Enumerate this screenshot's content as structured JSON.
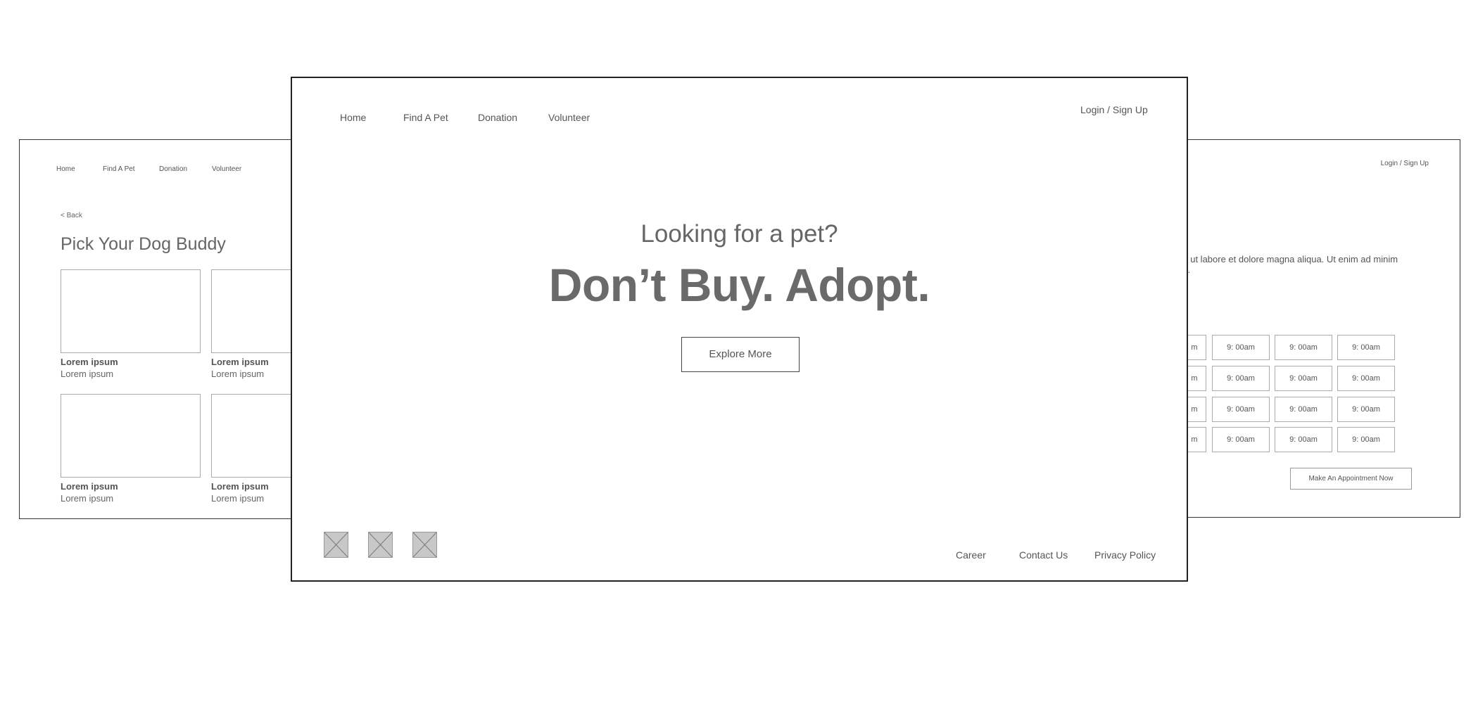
{
  "nav": {
    "home": "Home",
    "find_pet": "Find A Pet",
    "donation": "Donation",
    "volunteer": "Volunteer",
    "login": "Login / Sign Up"
  },
  "left_page": {
    "back": "< Back",
    "title": "Pick Your Dog Buddy",
    "cards": [
      {
        "title": "Lorem ipsum",
        "subtitle": "Lorem ipsum"
      },
      {
        "title": "Lorem ipsum",
        "subtitle": "Lorem ipsum"
      },
      {
        "title": "Lorem ipsum",
        "subtitle": "Lorem ipsum"
      },
      {
        "title": "Lorem ipsum",
        "subtitle": "Lorem ipsum"
      }
    ]
  },
  "hero": {
    "subtitle": "Looking for a pet?",
    "title": "Don’t Buy. Adopt.",
    "cta": "Explore More"
  },
  "footer": {
    "social_icons": [
      "image-placeholder-icon",
      "image-placeholder-icon",
      "image-placeholder-icon"
    ],
    "links": [
      "Career",
      "Contact Us",
      "Privacy Policy"
    ]
  },
  "right_page": {
    "paragraph_line1": "t ut labore et dolore magna aliqua. Ut enim ad minim",
    "paragraph_line2": "t.",
    "slots": [
      [
        "m",
        "9: 00am",
        "9: 00am",
        "9: 00am"
      ],
      [
        "m",
        "9: 00am",
        "9: 00am",
        "9: 00am"
      ],
      [
        "m",
        "9: 00am",
        "9: 00am",
        "9: 00am"
      ],
      [
        "m",
        "9: 00am",
        "9: 00am",
        "9: 00am"
      ]
    ],
    "appointment_button": "Make An Appointment Now"
  },
  "colors": {
    "frame_border": "#222222",
    "placeholder_fill": "#c8c8c8",
    "text": "#555555"
  }
}
